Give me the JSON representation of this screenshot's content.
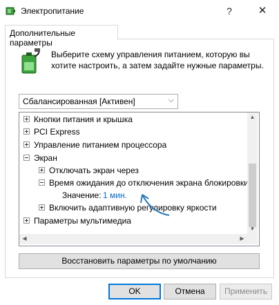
{
  "window": {
    "title": "Электропитание",
    "help_label": "?",
    "close_label": "✕"
  },
  "tab": {
    "label": "Дополнительные параметры"
  },
  "description": "Выберите схему управления питанием, которую вы хотите настроить, а затем задайте нужные параметры.",
  "scheme_select": {
    "value": "Сбалансированная [Активен]"
  },
  "tree": {
    "items": [
      {
        "label": "Кнопки питания и крышка",
        "expander": "plus"
      },
      {
        "label": "PCI Express",
        "expander": "plus"
      },
      {
        "label": "Управление питанием процессора",
        "expander": "plus"
      },
      {
        "label": "Экран",
        "expander": "minus"
      },
      {
        "label": "Отключать экран через",
        "expander": "plus"
      },
      {
        "label": "Время ожидания до отключения экрана блокировки",
        "expander": "minus"
      },
      {
        "label": "Значение:",
        "value": "1 мин."
      },
      {
        "label": "Включить адаптивную регулировку яркости",
        "expander": "plus"
      },
      {
        "label": "Параметры мультимедиа",
        "expander": "plus"
      }
    ]
  },
  "buttons": {
    "restore": "Восстановить параметры по умолчанию",
    "ok": "OK",
    "cancel": "Отмена",
    "apply": "Применить"
  },
  "icons": {
    "app": "power-options-icon",
    "battery": "battery-plug-icon"
  },
  "colors": {
    "link": "#0066cc",
    "annotation_arrow": "#2a7ab8",
    "ok_border": "#0078d7"
  }
}
